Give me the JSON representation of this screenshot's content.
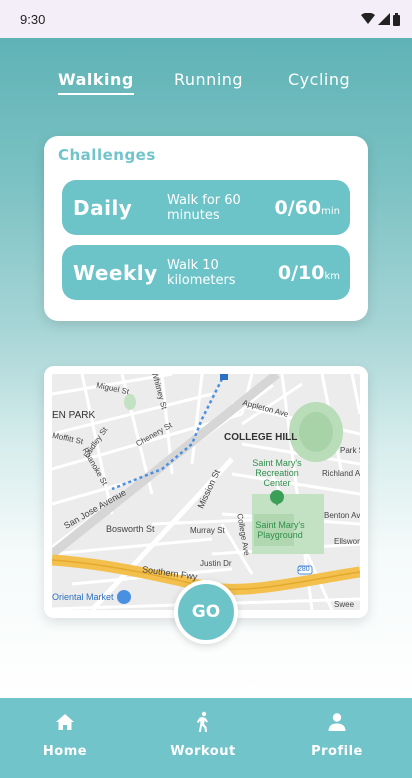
{
  "status_bar": {
    "time": "9:30"
  },
  "tabs": [
    {
      "label": "Walking",
      "active": true
    },
    {
      "label": "Running",
      "active": false
    },
    {
      "label": "Cycling",
      "active": false
    }
  ],
  "challenges": {
    "title": "Challenges",
    "items": [
      {
        "period": "Daily",
        "description": "Walk for 60 minutes",
        "progress": "0/60",
        "unit": "min"
      },
      {
        "period": "Weekly",
        "description": "Walk 10 kilometers",
        "progress": "0/10",
        "unit": "km"
      }
    ]
  },
  "map": {
    "labels": {
      "en_park": "EN PARK",
      "college_hill": "COLLEGE HILL",
      "saint_marys_rec": "Saint Mary's Recreation Center",
      "saint_marys_playground": "Saint Mary's Playground",
      "san_jose_ave": "San Jose Avenue",
      "bosworth": "Bosworth St",
      "southern_fwy": "Southern Fwy",
      "oriental_market": "Oriental Market",
      "mission_st": "Mission St",
      "murray_st": "Murray St",
      "college_ave": "College Ave",
      "justin_dr": "Justin Dr",
      "appleton": "Appleton Ave",
      "richland": "Richland Ave",
      "benton": "Benton Ave",
      "park_st": "Park St",
      "ellsworth": "Ellsworth",
      "miguel": "Miguel St",
      "whitney": "Whitney St",
      "moffitt": "Moffitt St",
      "laidley": "Laidley St",
      "roanoke": "Roanoke St",
      "chenery": "Chenery St",
      "highway_280": "280",
      "swee": "Swee"
    }
  },
  "go_button": {
    "label": "GO"
  },
  "nav": [
    {
      "label": "Home",
      "icon": "home-icon"
    },
    {
      "label": "Workout",
      "icon": "walking-icon"
    },
    {
      "label": "Profile",
      "icon": "person-icon"
    }
  ],
  "colors": {
    "accent": "#6cc4c9",
    "gradient_top": "#5fb3b6",
    "nav_bg": "#72c4cb"
  }
}
